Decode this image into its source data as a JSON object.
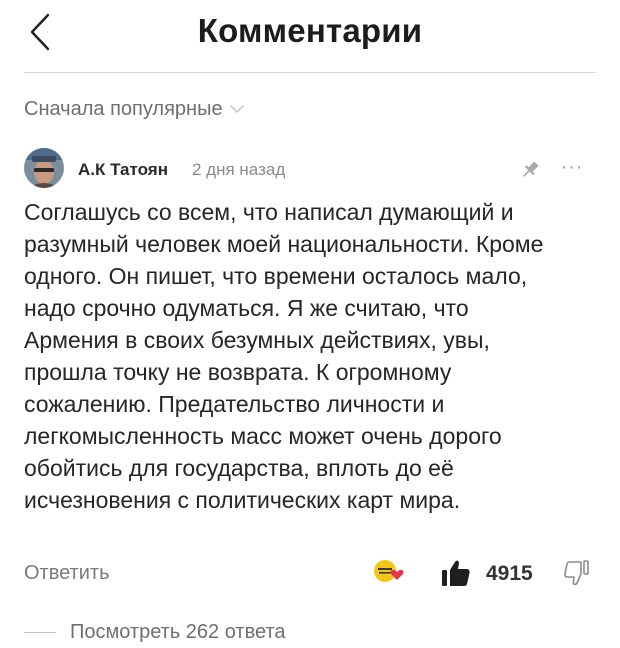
{
  "header": {
    "title": "Комментарии",
    "back_icon": "chevron-left-icon"
  },
  "sort": {
    "label": "Сначала популярные",
    "icon": "chevron-down-icon"
  },
  "comment": {
    "author": "А.К Татоян",
    "time": "2 дня назад",
    "text": "Соглашусь со всем, что написал думающий и разумный человек моей национальности. Кроме одного. Он пишет, что времени осталось мало, надо срочно одуматься. Я же считаю, что Армения в своих безумных действиях, увы, прошла точку не возврата. К огромному сожалению. Предательство личности и легкомысленность масс может очень дорого обойтись для государства, вплоть до её исчезновения с политических карт мира.",
    "more": "···",
    "actions": {
      "reply": "Ответить",
      "likes": "4915"
    }
  },
  "replies": {
    "label": "Посмотреть 262 ответа"
  },
  "colors": {
    "text": "#262626",
    "muted": "#7a7a7a",
    "reaction_yellow": "#f5c518",
    "reaction_heart": "#e8344e"
  }
}
